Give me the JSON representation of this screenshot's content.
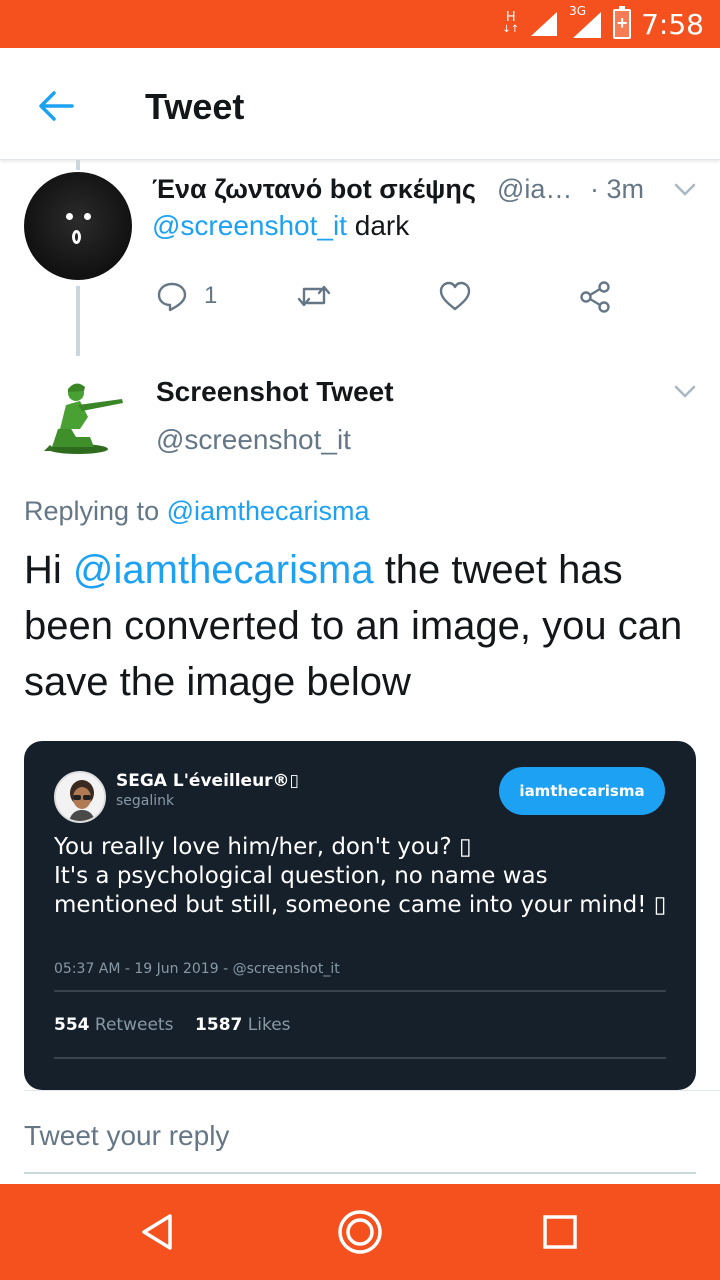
{
  "status_bar": {
    "network_h": "H",
    "network_h_arrows": "↓↑",
    "network_3g": "3G",
    "battery_glyph": "+",
    "time": "7:58"
  },
  "app_bar": {
    "title": "Tweet",
    "back_icon": "arrow-left-icon"
  },
  "parent_tweet": {
    "author_name": "Ένα ζωντανό bot σκέψης",
    "author_handle": "@ia…",
    "time": "· 3m",
    "mention": "@screenshot_it",
    "text": " dark",
    "reply_count": "1",
    "icons": [
      "reply-icon",
      "retweet-icon",
      "like-icon",
      "share-icon"
    ]
  },
  "main_tweet": {
    "author_name": "Screenshot Tweet",
    "author_handle": "@screenshot_it",
    "replying_prefix": "Replying to ",
    "replying_handle": "@iamthecarisma",
    "text_hi": "Hi ",
    "text_mention": "@iamthecarisma",
    "text_rest": " the tweet has been converted to an image, you can save the image below"
  },
  "embedded_image": {
    "name": "SEGA L'éveilleur®▯",
    "handle": "segalink",
    "pill": "iamthecarisma",
    "line1": "You really love him/her, don't you? ▯",
    "line2": "It's a psychological question, no name was mentioned but still, someone came into your mind! ▯",
    "meta": "05:37 AM - 19 Jun 2019 - @screenshot_it",
    "retweets_count": "554",
    "retweets_label": " Retweets",
    "likes_count": "1587",
    "likes_label": " Likes"
  },
  "reply_box": {
    "placeholder": "Tweet your reply"
  },
  "nav_bar": {
    "icons": [
      "back-triangle-icon",
      "home-circle-icon",
      "recents-square-icon"
    ]
  },
  "colors": {
    "accent": "#f4511e",
    "link": "#1da1f2",
    "muted": "#657786",
    "card_bg": "#15202b"
  }
}
